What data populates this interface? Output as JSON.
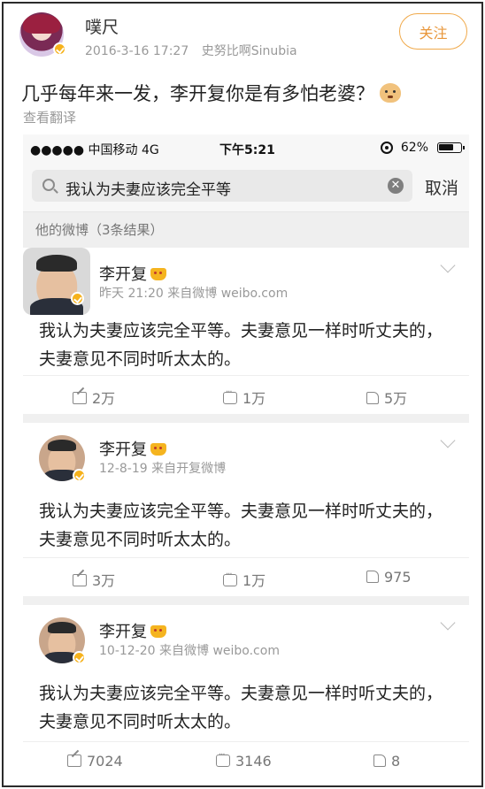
{
  "outer_post": {
    "username": "噗尺",
    "timestamp": "2016-3-16 17:27",
    "source": "史努比啊Sinubia",
    "follow_label": "关注",
    "text": "几乎每年来一发，李开复你是有多怕老婆？",
    "translate_label": "查看翻译"
  },
  "statusbar": {
    "carrier": "●●●●● 中国移动  4G",
    "time": "下午5:21",
    "battery": "62%"
  },
  "search": {
    "query": "我认为夫妻应该完全平等",
    "cancel_label": "取消"
  },
  "results_label": "他的微博（3条结果）",
  "posts": [
    {
      "author": "李开复",
      "meta": "昨天 21:20  来自微博 weibo.com",
      "text": "我认为夫妻应该完全平等。夫妻意见一样时听丈夫的，夫妻意见不同时听太太的。",
      "reposts": "2万",
      "comments": "1万",
      "likes": "5万"
    },
    {
      "author": "李开复",
      "meta": "12-8-19  来自开复微博",
      "text": "我认为夫妻应该完全平等。夫妻意见一样时听丈夫的，夫妻意见不同时听太太的。",
      "reposts": "3万",
      "comments": "1万",
      "likes": "975"
    },
    {
      "author": "李开复",
      "meta": "10-12-20  来自微博 weibo.com",
      "text": "我认为夫妻应该完全平等。夫妻意见一样时听丈夫的，夫妻意见不同时听太太的。",
      "reposts": "7024",
      "comments": "3146",
      "likes": "8"
    }
  ],
  "colors": {
    "follow_accent": "#e8963a",
    "verified_badge": "#f6b21c",
    "muted_text": "#999999"
  }
}
